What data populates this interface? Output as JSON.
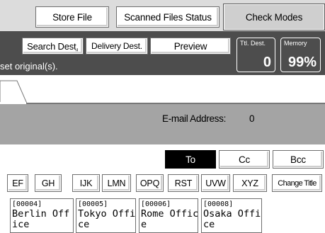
{
  "toolbar": {
    "store_file": "Store File",
    "scanned_files_status": "Scanned Files Status",
    "check_modes": "Check Modes"
  },
  "header": {
    "search_dest": "Search Dest",
    "search_dest_suffix": ".",
    "delivery_dest": "Delivery Dest.",
    "preview": "Preview",
    "status_text": "set original(s).",
    "total_dest_label": "Ttl. Dest.",
    "total_dest_value": "0",
    "memory_label": "Memory",
    "memory_value": "99%"
  },
  "destination": {
    "email_label": "E-mail Address:",
    "email_count": "0",
    "to": "To",
    "cc": "Cc",
    "bcc": "Bcc"
  },
  "letter_tabs": [
    "EF",
    "GH",
    "IJK",
    "LMN",
    "OPQ",
    "RST",
    "UVW",
    "XYZ",
    "Change Title"
  ],
  "entries": [
    {
      "code": "[00004]",
      "name": "Berlin Office"
    },
    {
      "code": "[00005]",
      "name": "Tokyo Office"
    },
    {
      "code": "[00006]",
      "name": "Rome Office"
    },
    {
      "code": "[00008]",
      "name": "Osaka Office"
    }
  ],
  "colors": {
    "header_bg": "#4d4d4d",
    "dest_header_bg": "#a4a4a4",
    "selected_button_bg": "#000000"
  }
}
